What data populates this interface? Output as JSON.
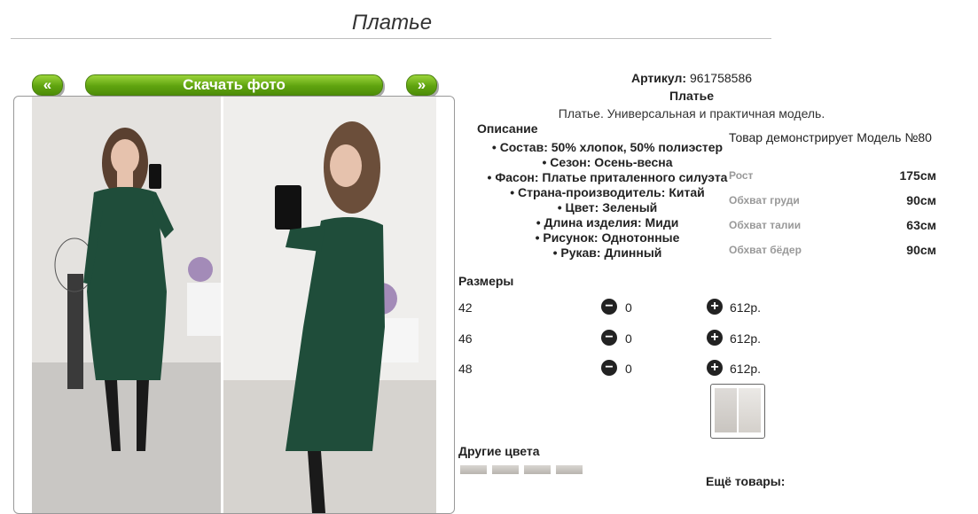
{
  "page": {
    "title": "Платье"
  },
  "buttons": {
    "prev": "«",
    "download": "Скачать фото",
    "next": "»"
  },
  "product": {
    "article_label": "Артикул:",
    "article_value": "961758586",
    "name": "Платье",
    "short_description": "Платье. Универсальная и практичная модель."
  },
  "description": {
    "title": "Описание",
    "properties": [
      "Состав: 50% хлопок, 50% полиэстер",
      "Сезон: Осень-весна",
      "Фасон: Платье приталенного силуэта",
      "Страна-производитель: Китай",
      "Цвет: Зеленый",
      "Длина изделия: Миди",
      "Рисунок: Однотонные",
      "Рукав: Длинный"
    ]
  },
  "model": {
    "text": "Товар демонстрирует Модель №80",
    "measurements": [
      {
        "label": "Рост",
        "value": "175см"
      },
      {
        "label": "Обхват груди",
        "value": "90см"
      },
      {
        "label": "Обхват талии",
        "value": "63см"
      },
      {
        "label": "Обхват бёдер",
        "value": "90см"
      }
    ]
  },
  "sizes": {
    "title": "Размеры",
    "minus_icon": "minus-circle-icon",
    "plus_icon": "plus-circle-icon",
    "rows": [
      {
        "size": "42",
        "qty": "0",
        "price": "612р."
      },
      {
        "size": "46",
        "qty": "0",
        "price": "612р."
      },
      {
        "size": "48",
        "qty": "0",
        "price": "612р."
      }
    ]
  },
  "other_colors": {
    "title": "Другие цвета"
  },
  "more_items": {
    "title": "Ещё товары:"
  },
  "colors": {
    "accent_green": "#5fa30f",
    "dress_green": "#1f4d3a"
  }
}
